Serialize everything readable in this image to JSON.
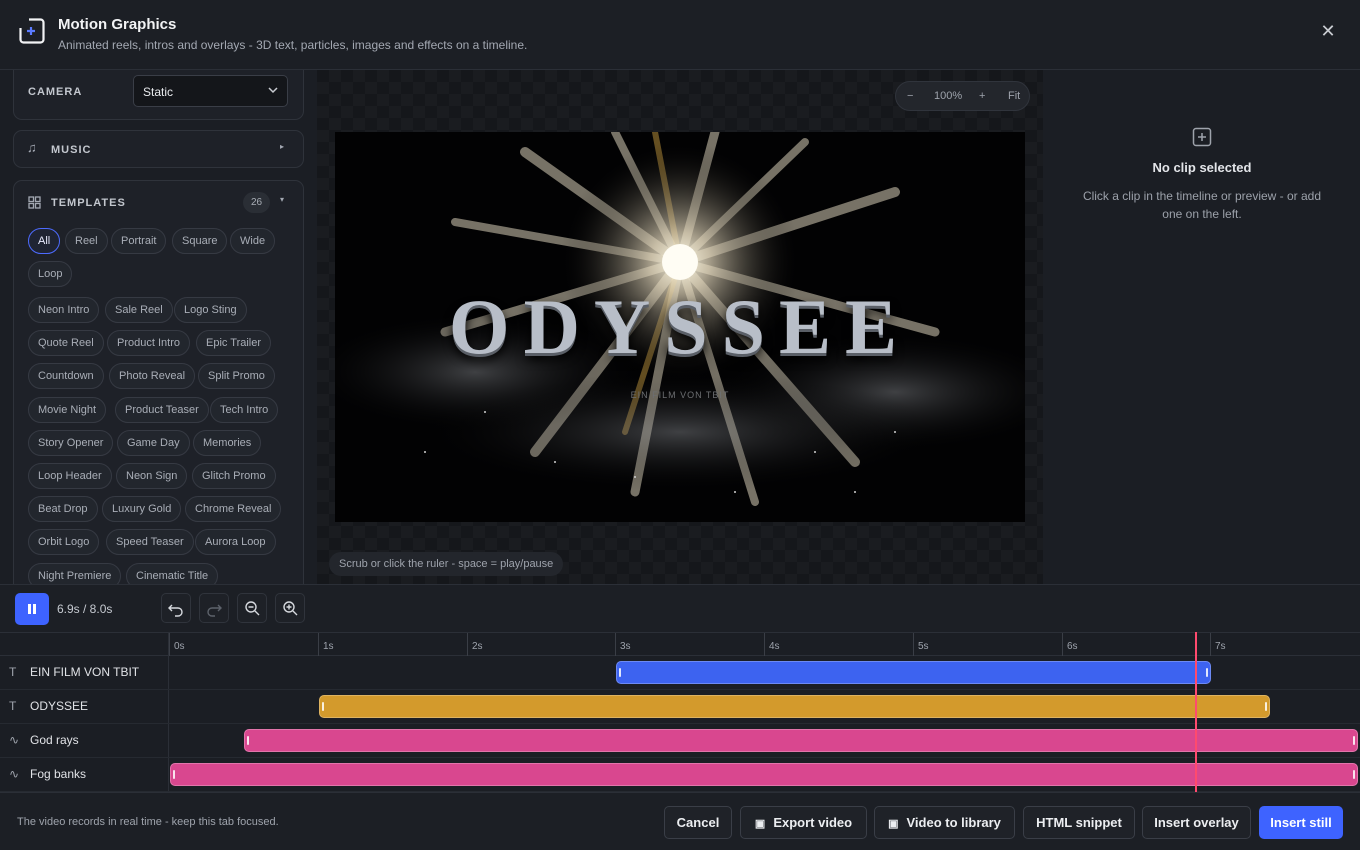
{
  "header": {
    "title": "Motion Graphics",
    "subtitle": "Animated reels, intros and overlays - 3D text, particles, images and effects on a timeline.",
    "close_icon": "close-icon"
  },
  "left_panel": {
    "camera": {
      "label": "CAMERA",
      "value": "Static"
    },
    "music": {
      "label": "MUSIC"
    },
    "templates": {
      "label": "TEMPLATES",
      "count": "26",
      "filters": [
        "All",
        "Reel",
        "Portrait",
        "Square",
        "Wide",
        "Loop"
      ],
      "active_filter": "All",
      "items": [
        "Neon Intro",
        "Sale Reel",
        "Logo Sting",
        "Quote Reel",
        "Product Intro",
        "Epic Trailer",
        "Countdown",
        "Photo Reveal",
        "Split Promo",
        "Movie Night",
        "Product Teaser",
        "Tech Intro",
        "Story Opener",
        "Game Day",
        "Memories",
        "Loop Header",
        "Neon Sign",
        "Glitch Promo",
        "Beat Drop",
        "Luxury Gold",
        "Chrome Reveal",
        "Orbit Logo",
        "Speed Teaser",
        "Aurora Loop",
        "Night Premiere",
        "Cinematic Title"
      ]
    }
  },
  "preview": {
    "zoom": {
      "minus": "−",
      "level": "100%",
      "plus": "+",
      "fit": "Fit"
    },
    "canvas_title": "ODYSSEE",
    "canvas_subtitle": "EIN FILM VON TBIT",
    "hint": "Scrub or click the ruler - space = play/pause"
  },
  "inspector": {
    "title": "No clip selected",
    "text": "Click a clip in the timeline or preview - or add one on the left."
  },
  "timeline": {
    "time": "6.9s / 8.0s",
    "current_time": 6.9,
    "duration": 8.0,
    "ruler": [
      "0s",
      "1s",
      "2s",
      "3s",
      "4s",
      "5s",
      "6s",
      "7s"
    ],
    "tracks": [
      {
        "name": "EIN FILM VON TBIT",
        "icon": "text-icon",
        "glyph": "T",
        "start": 3.0,
        "end": 7.0,
        "color": "#3d63f0"
      },
      {
        "name": "ODYSSEE",
        "icon": "text-icon",
        "glyph": "T",
        "start": 1.0,
        "end": 7.4,
        "color": "#d39a2c"
      },
      {
        "name": "God rays",
        "icon": "effect-icon",
        "glyph": "∿",
        "start": 0.5,
        "end": 8.0,
        "color": "#d9478f"
      },
      {
        "name": "Fog banks",
        "icon": "effect-icon",
        "glyph": "∿",
        "start": 0.0,
        "end": 8.0,
        "color": "#d9478f"
      }
    ]
  },
  "footer": {
    "note": "The video records in real time - keep this tab focused.",
    "buttons": {
      "cancel": "Cancel",
      "export_video": "Export video",
      "video_to_library": "Video to library",
      "html_snippet": "HTML snippet",
      "insert_overlay": "Insert overlay",
      "insert_still": "Insert still"
    },
    "accent": "#3e63ff"
  }
}
